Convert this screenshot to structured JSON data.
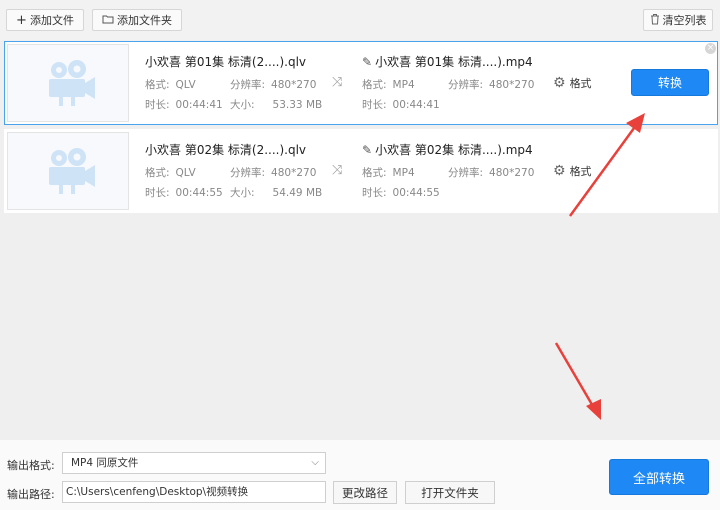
{
  "toolbar": {
    "add_file_icon": "plus-icon",
    "add_file_label": "添加文件",
    "add_folder_icon": "folder-icon",
    "add_folder_label": "添加文件夹",
    "clear_icon": "trash-icon",
    "clear_label": "清空列表"
  },
  "files": [
    {
      "src_name": "小欢喜 第01集 标清(2....).qlv",
      "src_format_label": "格式:",
      "src_format": "QLV",
      "src_res_label": "分辨率:",
      "src_res": "480*270",
      "src_dur_label": "时长:",
      "src_dur": "00:44:41",
      "src_size_label": "大小:",
      "src_size": "53.33 MB",
      "out_name": "小欢喜 第01集 标清....).mp4",
      "out_format_label": "格式:",
      "out_format": "MP4",
      "out_res_label": "分辨率:",
      "out_res": "480*270",
      "out_dur_label": "时长:",
      "out_dur": "00:44:41",
      "format_btn": "格式",
      "convert_btn": "转换"
    },
    {
      "src_name": "小欢喜 第02集 标清(2....).qlv",
      "src_format_label": "格式:",
      "src_format": "QLV",
      "src_res_label": "分辨率:",
      "src_res": "480*270",
      "src_dur_label": "时长:",
      "src_dur": "00:44:55",
      "src_size_label": "大小:",
      "src_size": "54.49 MB",
      "out_name": "小欢喜 第02集 标清....).mp4",
      "out_format_label": "格式:",
      "out_format": "MP4",
      "out_res_label": "分辨率:",
      "out_res": "480*270",
      "out_dur_label": "时长:",
      "out_dur": "00:44:55",
      "format_btn": "格式"
    }
  ],
  "bottom": {
    "output_format_label": "输出格式:",
    "output_format_value": "MP4  同原文件",
    "output_path_label": "输出路径:",
    "output_path_value": "C:\\Users\\cenfeng\\Desktop\\视频转换",
    "change_path_btn": "更改路径",
    "open_folder_btn": "打开文件夹",
    "convert_all_btn": "全部转换"
  },
  "colors": {
    "accent": "#1e88f4",
    "selected_border": "#4aa3ef",
    "annotation_arrow": "#e8413b"
  }
}
